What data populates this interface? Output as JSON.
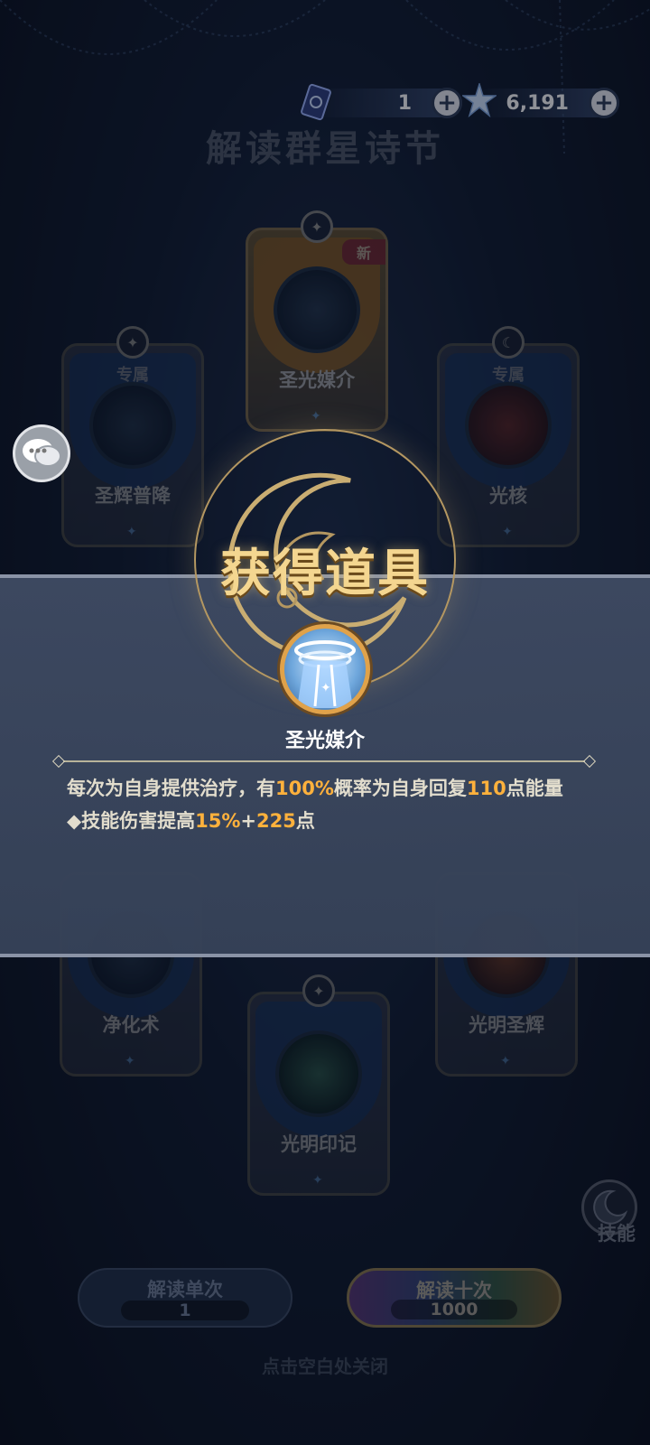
{
  "top_bar": {
    "ticket_count": "1",
    "star_count": "6,191",
    "plus_label": "+"
  },
  "title": "解读群星诗节",
  "cards": {
    "top": {
      "name": "圣光媒介",
      "badge": "新"
    },
    "left_upper": {
      "name": "圣辉普降",
      "tag": "专属"
    },
    "right_upper": {
      "name": "光核",
      "tag": "专属"
    },
    "left_lower": {
      "name": "净化术"
    },
    "right_lower": {
      "name": "光明圣辉"
    },
    "bottom": {
      "name": "光明印记"
    }
  },
  "buttons": {
    "single": {
      "label": "解读单次",
      "cost": "1"
    },
    "ten": {
      "label": "解读十次",
      "cost": "1000"
    },
    "skill": "技能"
  },
  "close_hint": "点击空白处关闭",
  "popup": {
    "heading": "获得道具",
    "item_name": "圣光媒介",
    "desc_line1_a": "每次为自身提供治疗，有",
    "desc_line1_pct": "100%",
    "desc_line1_b": "概率为自身回复",
    "desc_line1_num": "110",
    "desc_line1_c": "点能量",
    "desc_line2_a": "◆技能伤害提高",
    "desc_line2_pct": "15%",
    "desc_line2_plus": "+",
    "desc_line2_num": "225",
    "desc_line2_b": "点"
  },
  "colors": {
    "highlight": "#ffb13c",
    "heading": "#f4d690",
    "panel": "#3e4a62"
  },
  "icons": [
    "ticket-icon",
    "star-crystal-icon",
    "chat-icon",
    "moon-icon",
    "skill-icon"
  ]
}
